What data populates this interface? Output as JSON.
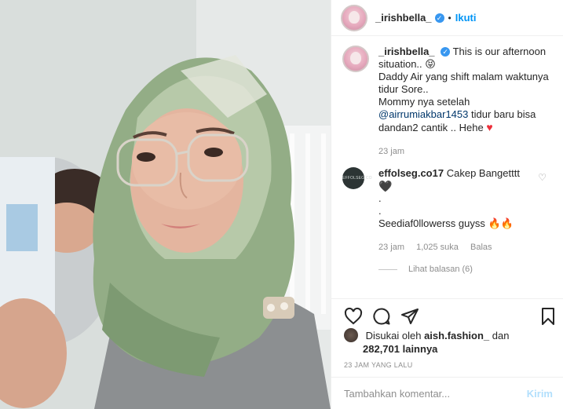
{
  "header": {
    "username": "_irishbella_",
    "follow_label": "Ikuti",
    "separator": "•"
  },
  "caption": {
    "username": "_irishbella_",
    "text_1": "This is our afternoon situation..",
    "text_2": "Daddy Air yang shift malam waktunya tidur Sore..",
    "text_3": "Mommy nya setelah",
    "mention": "@airrumiakbar1453",
    "text_4": "tidur baru bisa dandan2 cantik .. Hehe",
    "time": "23 jam"
  },
  "comment": {
    "avatar_label": "EFFOLSEG.CO",
    "username": "effolseg.co17",
    "text_1": "Cakep Bangetttt",
    "dot_1": ".",
    "dot_2": ".",
    "text_2": "Seediaf0llowerss guyss",
    "time": "23 jam",
    "likes": "1,025 suka",
    "reply_label": "Balas",
    "view_replies": "Lihat balasan (6)"
  },
  "likes": {
    "prefix": "Disukai oleh",
    "user": "aish.fashion_",
    "conj": "dan",
    "count": "282,701 lainnya"
  },
  "timestamp": "23 JAM YANG LALU",
  "add_comment": {
    "placeholder": "Tambahkan komentar...",
    "post_label": "Kirim"
  },
  "icons": {
    "heart": "heart-icon",
    "comment": "comment-icon",
    "share": "share-icon",
    "save": "bookmark-icon",
    "verified": "verified-badge-icon"
  },
  "colors": {
    "link_blue": "#0095f6",
    "muted_gray": "#8e8e8e",
    "heart_red": "#ed2f3a",
    "post_disabled": "#b2dffc"
  }
}
